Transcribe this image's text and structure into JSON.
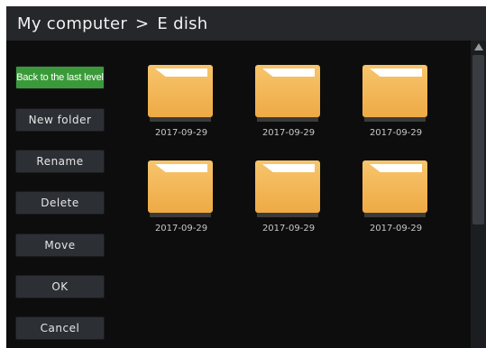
{
  "header": {
    "root": "My computer",
    "separator": ">",
    "current": "E dish"
  },
  "sidebar": {
    "buttons": [
      {
        "id": "back",
        "label": "Back to the last level"
      },
      {
        "id": "new-folder",
        "label": "New folder"
      },
      {
        "id": "rename",
        "label": "Rename"
      },
      {
        "id": "delete",
        "label": "Delete"
      },
      {
        "id": "move",
        "label": "Move"
      },
      {
        "id": "ok",
        "label": "OK"
      },
      {
        "id": "cancel",
        "label": "Cancel"
      }
    ]
  },
  "folders": [
    {
      "date": "2017-09-29"
    },
    {
      "date": "2017-09-29"
    },
    {
      "date": "2017-09-29"
    },
    {
      "date": "2017-09-29"
    },
    {
      "date": "2017-09-29"
    },
    {
      "date": "2017-09-29"
    }
  ],
  "colors": {
    "accent_green": "#3a9a3a",
    "folder_orange": "#f2b552",
    "background": "#0d0d0e"
  }
}
